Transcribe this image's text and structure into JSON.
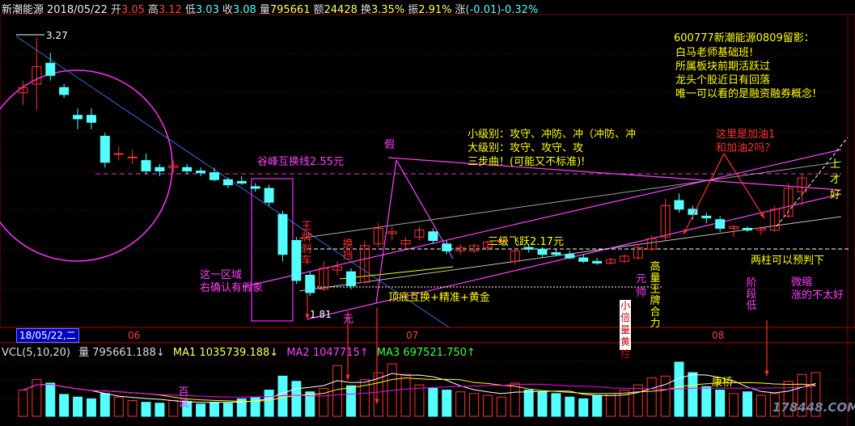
{
  "header": {
    "name": "新潮能源",
    "date": "2018/05/22",
    "open_label": "开",
    "open": "3.05",
    "high_label": "高",
    "high": "3.12",
    "low_label": "低",
    "low": "3.03",
    "close_label": "收",
    "close": "3.08",
    "vol_label": "量",
    "vol": "795661",
    "amount_label": "额",
    "amount": "24428",
    "turnover_label": "换",
    "turnover": "3.35%",
    "amp_label": "振",
    "amp": "2.91%",
    "change_label": "涨",
    "change": "(-0.01)-0.32%"
  },
  "annotations": {
    "note_title": "600777新潮能源0809留影：",
    "note_lines": [
      "白马老师基础班!",
      "所属板块前期活跃过",
      "龙头个股近日有回落",
      "唯一可以看的是融资融券概念!"
    ],
    "levels_lines": [
      "小级别：攻守、冲防、冲（冲防、冲",
      "大级别：攻守、攻守、攻",
      "三步曲！(可能又不标准)!"
    ],
    "refuel": [
      "这里是加油1",
      "和加油2吗？"
    ],
    "peak_line": "谷峰互换线2.55元",
    "fake": "假",
    "jump": "三级飞跃2.17元",
    "region": [
      "这一区域",
      "右确认有假象"
    ],
    "bottom_swap": "顶底互换+精准+黄金",
    "two_columns": "两柱可以预判下",
    "tiny": [
      "微缩",
      "涨的不太好"
    ],
    "up": "上",
    "dao": "才",
    "hao": "好",
    "brake": "王牌刹车",
    "change_gear": "换挡",
    "yuan": "元",
    "high_king": "高量王牌合力",
    "little_double": "小倍量黄柱",
    "shuai": "帅",
    "stage_low": "阶段低",
    "kangqiao": "康桥",
    "hundred": "百试",
    "low_price": "1.81",
    "high_price": "3.27"
  },
  "dates": {
    "cursor": "18/05/22,二",
    "m06": "06",
    "m07": "07",
    "m08": "08"
  },
  "volume_panel": {
    "title": "VCL(5,10,20)",
    "vol_label": "量",
    "vol_value": "795661.188↓",
    "ma1_label": "MA1",
    "ma1_value": "1035739.188↓",
    "ma2_label": "MA2",
    "ma2_value": "1047715↑",
    "ma3_label": "MA3",
    "ma3_value": "697521.750↑"
  },
  "watermark": "178448.COM",
  "colors": {
    "up": "#ff3232",
    "down": "#54ffff",
    "ma1": "#ffffff",
    "ma2": "#ffff00",
    "ma3": "#ff00ff",
    "annot": "#ffff00",
    "magenta": "#ff30ff",
    "red": "#ff4040"
  },
  "chart_data": {
    "type": "candlestick",
    "ylim": [
      1.6,
      3.4
    ],
    "candles": [
      {
        "o": 2.95,
        "h": 3.02,
        "l": 2.88,
        "c": 2.98
      },
      {
        "o": 3.0,
        "h": 3.27,
        "l": 2.85,
        "c": 3.1
      },
      {
        "o": 3.12,
        "h": 3.18,
        "l": 3.02,
        "c": 3.05
      },
      {
        "o": 2.98,
        "h": 3.0,
        "l": 2.92,
        "c": 2.94
      },
      {
        "o": 2.82,
        "h": 2.86,
        "l": 2.74,
        "c": 2.8
      },
      {
        "o": 2.82,
        "h": 2.86,
        "l": 2.74,
        "c": 2.78
      },
      {
        "o": 2.7,
        "h": 2.72,
        "l": 2.52,
        "c": 2.55
      },
      {
        "o": 2.6,
        "h": 2.64,
        "l": 2.56,
        "c": 2.6
      },
      {
        "o": 2.58,
        "h": 2.62,
        "l": 2.54,
        "c": 2.58
      },
      {
        "o": 2.56,
        "h": 2.6,
        "l": 2.48,
        "c": 2.5
      },
      {
        "o": 2.52,
        "h": 2.54,
        "l": 2.47,
        "c": 2.5
      },
      {
        "o": 2.52,
        "h": 2.56,
        "l": 2.49,
        "c": 2.53
      },
      {
        "o": 2.52,
        "h": 2.54,
        "l": 2.48,
        "c": 2.5
      },
      {
        "o": 2.5,
        "h": 2.52,
        "l": 2.47,
        "c": 2.49
      },
      {
        "o": 2.49,
        "h": 2.52,
        "l": 2.44,
        "c": 2.45
      },
      {
        "o": 2.45,
        "h": 2.46,
        "l": 2.4,
        "c": 2.42
      },
      {
        "o": 2.44,
        "h": 2.47,
        "l": 2.42,
        "c": 2.43
      },
      {
        "o": 2.41,
        "h": 2.43,
        "l": 2.38,
        "c": 2.4
      },
      {
        "o": 2.4,
        "h": 2.42,
        "l": 2.3,
        "c": 2.32
      },
      {
        "o": 2.25,
        "h": 2.27,
        "l": 1.98,
        "c": 2.02
      },
      {
        "o": 2.1,
        "h": 2.12,
        "l": 1.85,
        "c": 1.87
      },
      {
        "o": 1.9,
        "h": 1.92,
        "l": 1.78,
        "c": 1.8
      },
      {
        "o": 1.82,
        "h": 1.98,
        "l": 1.81,
        "c": 1.94
      },
      {
        "o": 1.93,
        "h": 1.98,
        "l": 1.9,
        "c": 1.95
      },
      {
        "o": 1.92,
        "h": 1.94,
        "l": 1.82,
        "c": 1.84
      },
      {
        "o": 1.86,
        "h": 2.1,
        "l": 1.85,
        "c": 2.07
      },
      {
        "o": 2.08,
        "h": 2.2,
        "l": 2.06,
        "c": 2.17
      },
      {
        "o": 2.14,
        "h": 2.18,
        "l": 2.1,
        "c": 2.15
      },
      {
        "o": 2.08,
        "h": 2.12,
        "l": 2.05,
        "c": 2.1
      },
      {
        "o": 2.12,
        "h": 2.18,
        "l": 2.1,
        "c": 2.16
      },
      {
        "o": 2.15,
        "h": 2.17,
        "l": 2.08,
        "c": 2.1
      },
      {
        "o": 2.08,
        "h": 2.1,
        "l": 2.02,
        "c": 2.04
      },
      {
        "o": 2.04,
        "h": 2.08,
        "l": 2.02,
        "c": 2.06
      },
      {
        "o": 2.04,
        "h": 2.08,
        "l": 2.03,
        "c": 2.07
      },
      {
        "o": 2.06,
        "h": 2.1,
        "l": 2.04,
        "c": 2.09
      },
      {
        "o": 2.1,
        "h": 2.12,
        "l": 2.08,
        "c": 2.1
      },
      {
        "o": 1.98,
        "h": 2.06,
        "l": 1.96,
        "c": 2.04
      },
      {
        "o": 2.06,
        "h": 2.08,
        "l": 2.03,
        "c": 2.05
      },
      {
        "o": 2.05,
        "h": 2.06,
        "l": 2.0,
        "c": 2.02
      },
      {
        "o": 2.03,
        "h": 2.05,
        "l": 2.01,
        "c": 2.02
      },
      {
        "o": 2.02,
        "h": 2.04,
        "l": 1.99,
        "c": 2.0
      },
      {
        "o": 2.0,
        "h": 2.02,
        "l": 1.97,
        "c": 1.98
      },
      {
        "o": 1.98,
        "h": 2.0,
        "l": 1.96,
        "c": 1.97
      },
      {
        "o": 1.97,
        "h": 2.0,
        "l": 1.96,
        "c": 1.99
      },
      {
        "o": 1.98,
        "h": 2.02,
        "l": 1.97,
        "c": 2.01
      },
      {
        "o": 2.0,
        "h": 2.08,
        "l": 1.99,
        "c": 2.06
      },
      {
        "o": 2.05,
        "h": 2.13,
        "l": 2.04,
        "c": 2.11
      },
      {
        "o": 2.12,
        "h": 2.34,
        "l": 2.1,
        "c": 2.3
      },
      {
        "o": 2.33,
        "h": 2.37,
        "l": 2.26,
        "c": 2.28
      },
      {
        "o": 2.28,
        "h": 2.3,
        "l": 2.22,
        "c": 2.25
      },
      {
        "o": 2.24,
        "h": 2.26,
        "l": 2.2,
        "c": 2.23
      },
      {
        "o": 2.22,
        "h": 2.24,
        "l": 2.15,
        "c": 2.17
      },
      {
        "o": 2.17,
        "h": 2.19,
        "l": 2.12,
        "c": 2.18
      },
      {
        "o": 2.17,
        "h": 2.18,
        "l": 2.15,
        "c": 2.16
      },
      {
        "o": 2.16,
        "h": 2.18,
        "l": 2.13,
        "c": 2.17
      },
      {
        "o": 2.16,
        "h": 2.3,
        "l": 2.15,
        "c": 2.28
      },
      {
        "o": 2.24,
        "h": 2.43,
        "l": 2.23,
        "c": 2.4
      },
      {
        "o": 2.38,
        "h": 2.48,
        "l": 2.3,
        "c": 2.46
      }
    ],
    "volumes": [
      30,
      42,
      38,
      25,
      22,
      20,
      26,
      22,
      18,
      16,
      15,
      18,
      17,
      14,
      16,
      15,
      20,
      22,
      30,
      46,
      40,
      28,
      32,
      58,
      35,
      42,
      50,
      60,
      48,
      36,
      32,
      30,
      28,
      26,
      24,
      22,
      38,
      30,
      28,
      26,
      22,
      20,
      24,
      26,
      30,
      36,
      44,
      46,
      62,
      50,
      34,
      30,
      26,
      28,
      24,
      26,
      40,
      48,
      50
    ],
    "ma_lines": {
      "ma1": "MA1",
      "ma2": "MA2",
      "ma3": "MA3"
    }
  }
}
